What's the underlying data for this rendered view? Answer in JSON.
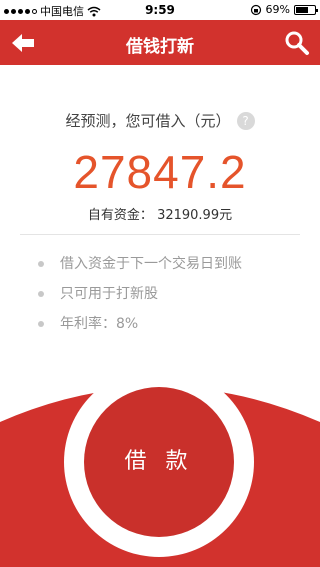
{
  "status_bar": {
    "carrier": "中国电信",
    "time": "9:59",
    "battery": "69%",
    "battery_level": 0.69,
    "signal_filled": 4,
    "signal_total": 5
  },
  "navbar": {
    "title": "借钱打新",
    "back_icon": "back-arrow-icon",
    "search_icon": "search-icon",
    "color": "#d2322d"
  },
  "main": {
    "predict_text": "经预测，您可借入（元）",
    "help_symbol": "?",
    "amount": "27847.2",
    "own_funds_label": "自有资金：",
    "own_funds_value": "32190.99元",
    "amount_color": "#e5542b"
  },
  "notes": [
    "借入资金于下一个交易日到账",
    "只可用于打新股",
    "年利率：8%"
  ],
  "borrow_button": {
    "label": "借 款",
    "color": "#c9302b"
  }
}
